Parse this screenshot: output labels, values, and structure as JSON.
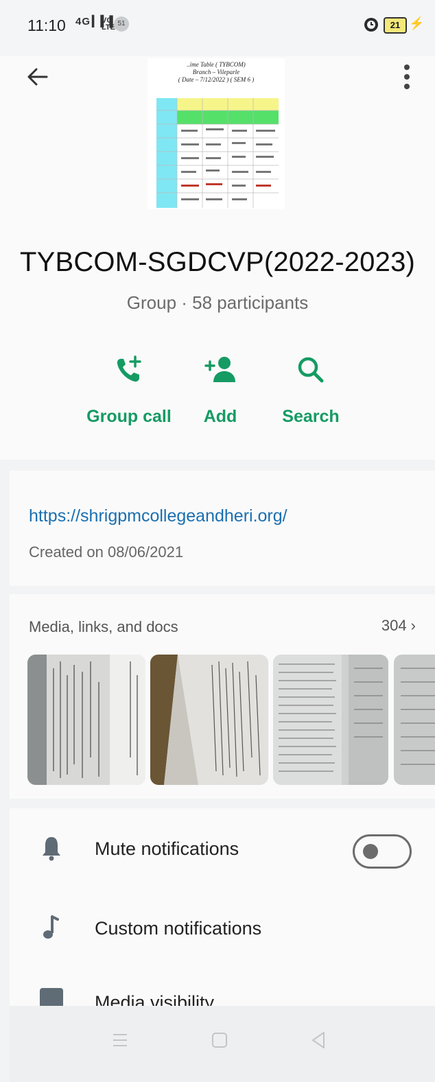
{
  "status_bar": {
    "time": "11:10",
    "signal": "4G ▎▍▌",
    "lte": "VO\nLTE",
    "notification_badge": "51",
    "battery": "21"
  },
  "group_image_caption": [
    "..ime Table ( TYBCOM)",
    "Branch – Vileparle",
    "( Date – 7/12/2022 ) ( SEM 6 )"
  ],
  "group": {
    "name": "TYBCOM-SGDCVP(2022-2023)",
    "meta": "Group · 58 participants"
  },
  "actions": [
    {
      "label": "Group call",
      "icon": "group-call-icon"
    },
    {
      "label": "Add",
      "icon": "add-person-icon"
    },
    {
      "label": "Search",
      "icon": "search-icon"
    }
  ],
  "description": {
    "link": "https://shrigpmcollegeandheri.org/",
    "created": "Created on 08/06/2021"
  },
  "media": {
    "title": "Media, links, and docs",
    "count": "304 ›"
  },
  "settings": [
    {
      "label": "Mute notifications",
      "icon": "bell-icon",
      "toggle": false
    },
    {
      "label": "Custom notifications",
      "icon": "music-note-icon"
    },
    {
      "label": "Media visibility",
      "icon": "media-visibility-icon"
    }
  ],
  "colors": {
    "accent": "#159b63",
    "link": "#1b6fb0"
  }
}
